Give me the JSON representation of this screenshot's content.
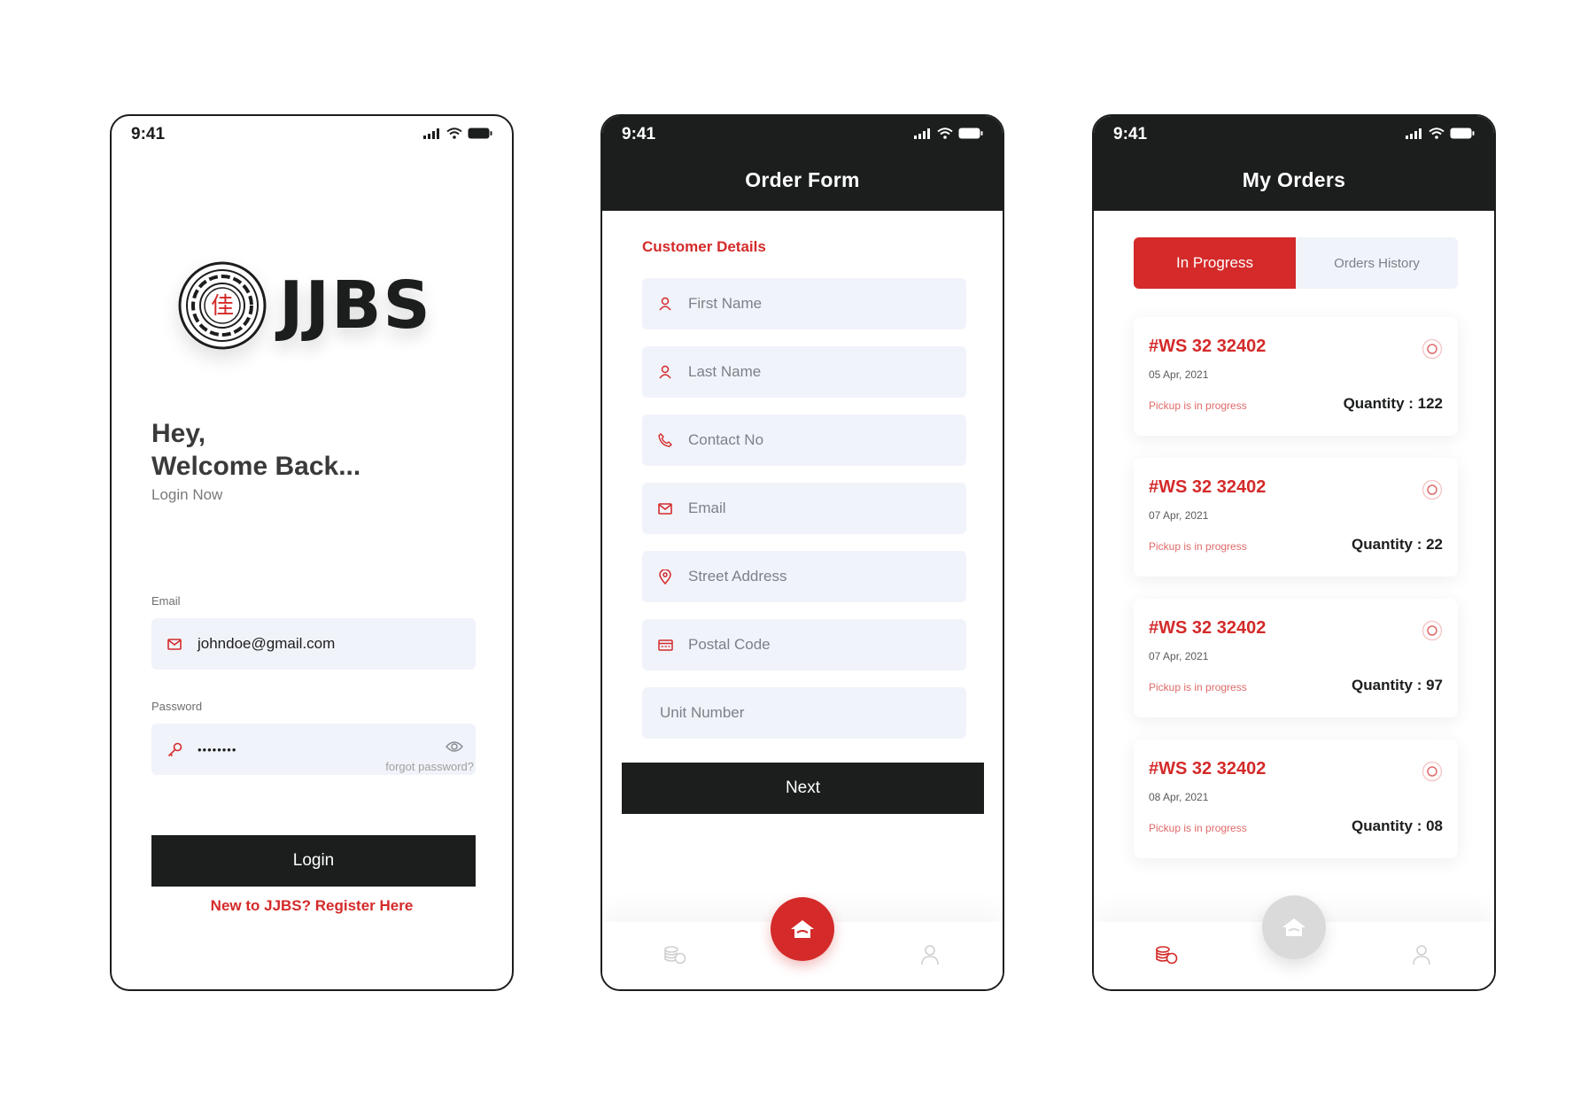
{
  "colors": {
    "brand_dark": "#1b1e1c",
    "accent_red": "#d42a2a",
    "field_bg": "#f1f3fa"
  },
  "status_bar": {
    "time": "9:41"
  },
  "login": {
    "logo_text": "JJBS",
    "logo_glyph": "佳",
    "greeting_line1": "Hey,",
    "greeting_line2": "Welcome Back...",
    "subtitle": "Login Now",
    "email_label": "Email",
    "email_value": "johndoe@gmail.com",
    "password_label": "Password",
    "password_value": "••••••••",
    "forgot_link": "forgot password?",
    "login_button": "Login",
    "register_link": "New to JJBS? Register Here"
  },
  "order_form": {
    "title": "Order Form",
    "section_title": "Customer Details",
    "fields": [
      {
        "placeholder": "First Name",
        "icon": "user-icon"
      },
      {
        "placeholder": "Last Name",
        "icon": "user-icon"
      },
      {
        "placeholder": "Contact No",
        "icon": "phone-icon"
      },
      {
        "placeholder": "Email",
        "icon": "mail-icon"
      },
      {
        "placeholder": "Street Address",
        "icon": "location-pin-icon"
      },
      {
        "placeholder": "Postal Code",
        "icon": "postal-card-icon"
      },
      {
        "placeholder": "Unit Number",
        "icon": ""
      }
    ],
    "next_button": "Next"
  },
  "my_orders": {
    "title": "My Orders",
    "tabs": [
      {
        "label": "In Progress",
        "active": true
      },
      {
        "label": "Orders History",
        "active": false
      }
    ],
    "orders": [
      {
        "id": "#WS 32 32402",
        "date": "05 Apr, 2021",
        "status": "Pickup is in progress",
        "quantity": "Quantity : 122"
      },
      {
        "id": "#WS 32 32402",
        "date": "07 Apr, 2021",
        "status": "Pickup is in progress",
        "quantity": "Quantity : 22"
      },
      {
        "id": "#WS 32 32402",
        "date": "07 Apr, 2021",
        "status": "Pickup is in progress",
        "quantity": "Quantity : 97"
      },
      {
        "id": "#WS 32 32402",
        "date": "08 Apr, 2021",
        "status": "Pickup is in progress",
        "quantity": "Quantity : 08"
      }
    ]
  },
  "bottom_nav": {
    "items": [
      {
        "icon": "coins-icon"
      },
      {
        "icon": "home-icon"
      },
      {
        "icon": "profile-icon"
      }
    ]
  }
}
